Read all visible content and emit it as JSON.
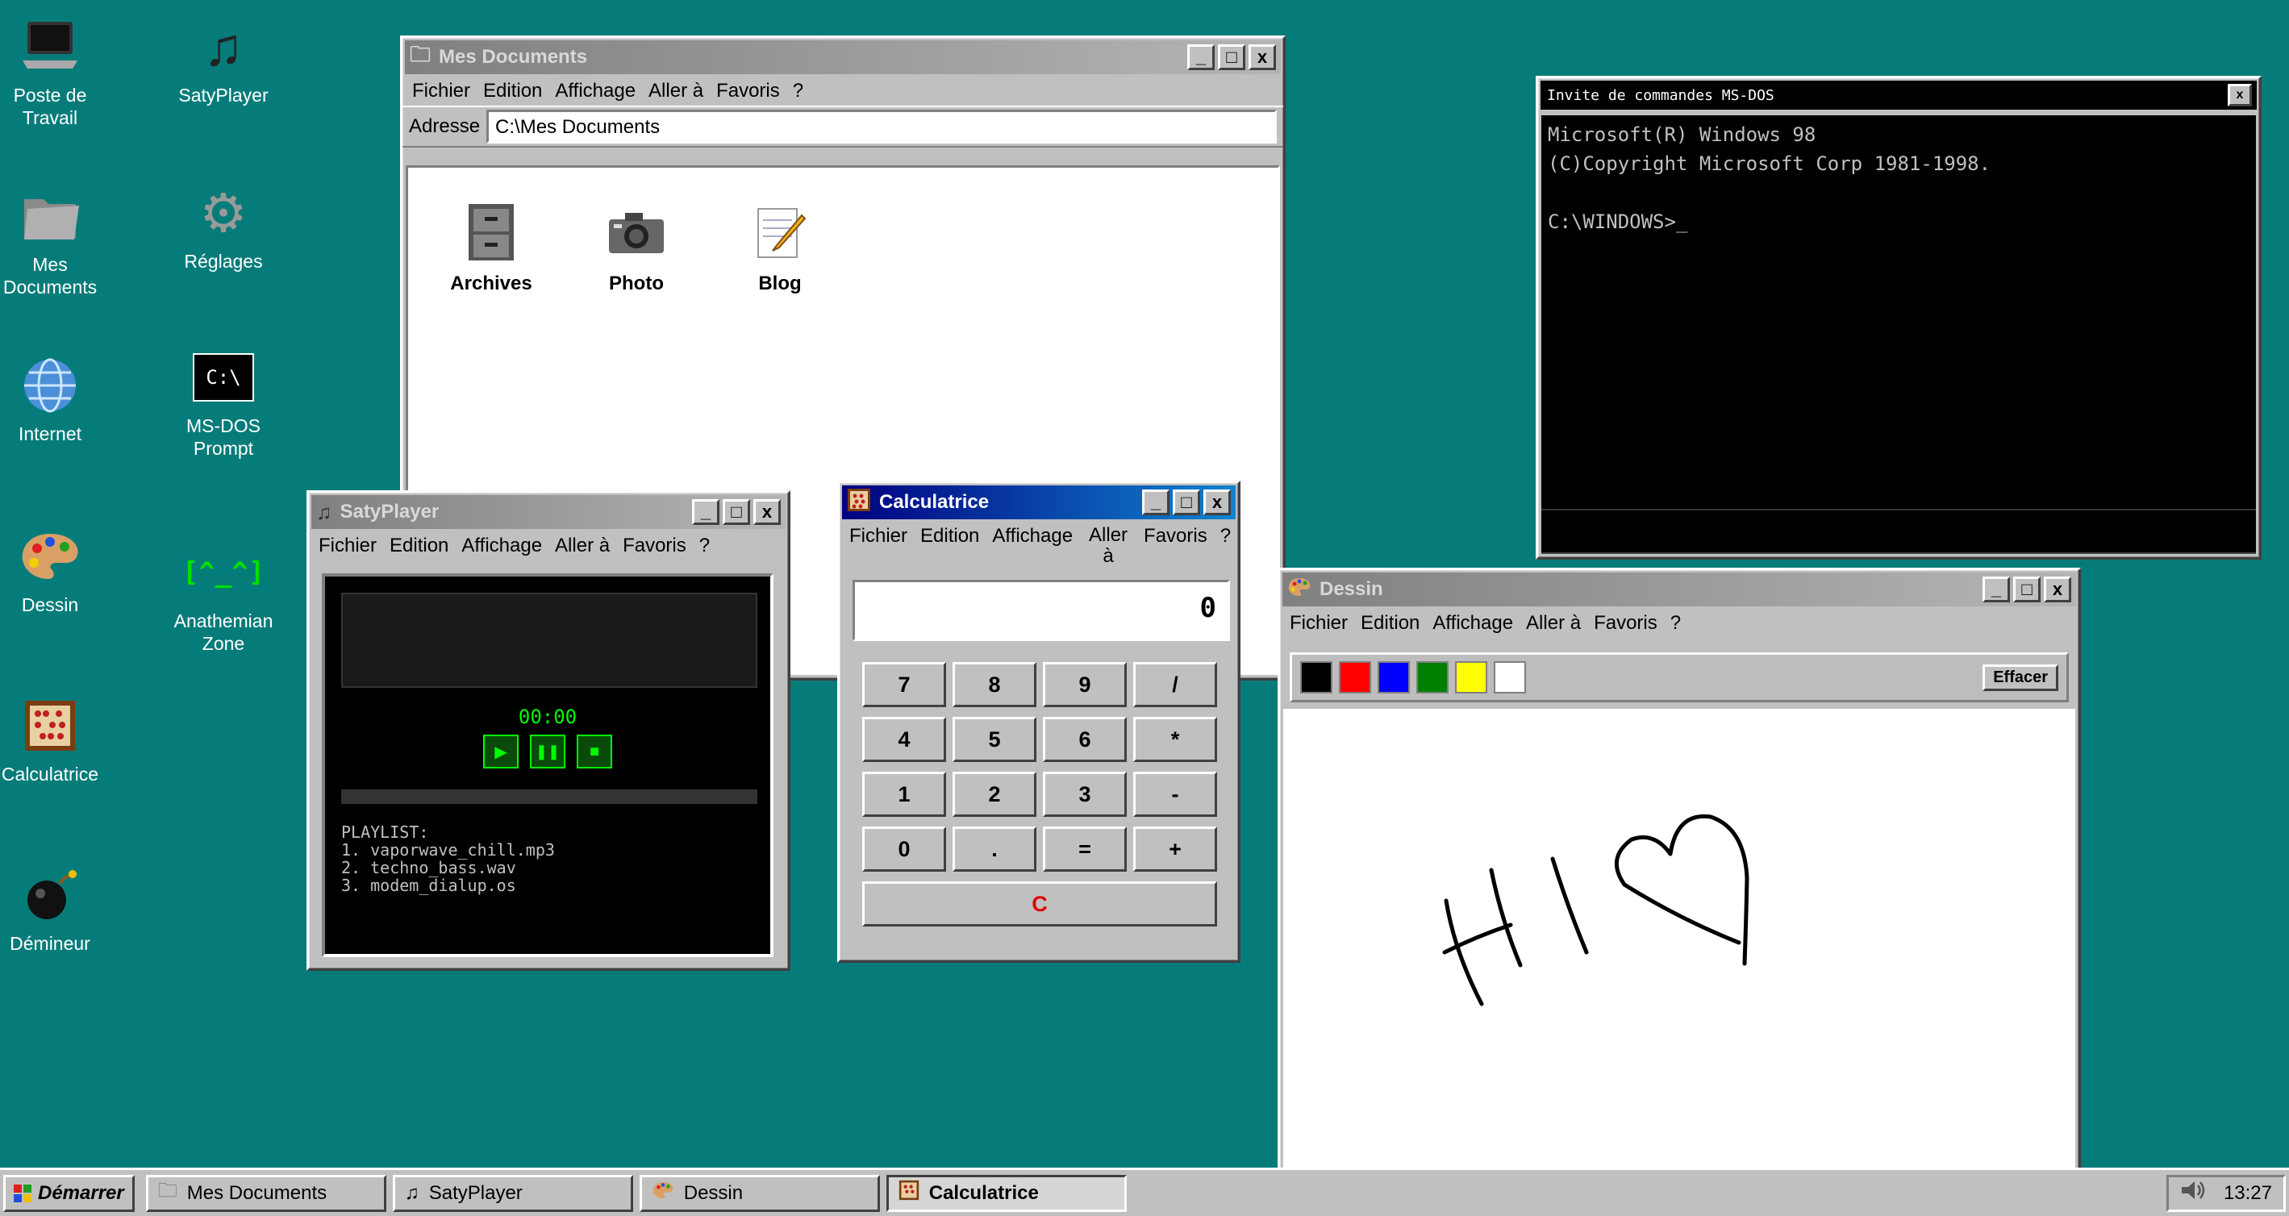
{
  "desktop": {
    "icons": [
      {
        "label": "Poste de Travail",
        "icon": "computer-icon"
      },
      {
        "label": "SatyPlayer",
        "icon": "music-note-icon"
      },
      {
        "label": "Mes Documents",
        "icon": "folder-icon"
      },
      {
        "label": "Réglages",
        "icon": "gear-icon"
      },
      {
        "label": "Internet",
        "icon": "globe-icon"
      },
      {
        "label": "MS-DOS Prompt",
        "icon": "terminal-icon",
        "glyph": "C:\\"
      },
      {
        "label": "Dessin",
        "icon": "palette-icon"
      },
      {
        "label": "Anathemian Zone",
        "icon": "ascii-face-icon",
        "glyph": "[^_^]"
      },
      {
        "label": "Calculatrice",
        "icon": "abacus-icon"
      },
      {
        "label": "Démineur",
        "icon": "bomb-icon"
      }
    ]
  },
  "explorer": {
    "title": "Mes Documents",
    "menu": [
      "Fichier",
      "Edition",
      "Affichage",
      "Aller à",
      "Favoris",
      "?"
    ],
    "address_label": "Adresse",
    "address_value": "C:\\Mes Documents",
    "items": [
      {
        "label": "Archives",
        "icon": "cabinet-icon"
      },
      {
        "label": "Photo",
        "icon": "camera-icon"
      },
      {
        "label": "Blog",
        "icon": "notepad-icon"
      }
    ]
  },
  "dos": {
    "title": "Invite de commandes MS-DOS",
    "lines": [
      "Microsoft(R) Windows 98",
      "(C)Copyright Microsoft Corp 1981-1998.",
      "",
      "C:\\WINDOWS>_"
    ]
  },
  "player": {
    "title": "SatyPlayer",
    "menu": [
      "Fichier",
      "Edition",
      "Affichage",
      "Aller à",
      "Favoris",
      "?"
    ],
    "time": "00:00",
    "controls": [
      "▶",
      "❚❚",
      "■"
    ],
    "playlist_header": "PLAYLIST:",
    "playlist": [
      "1. vaporwave_chill.mp3",
      "2. techno_bass.wav",
      "3. modem_dialup.os"
    ],
    "accent": "#00ff00"
  },
  "calc": {
    "title": "Calculatrice",
    "menu": [
      "Fichier",
      "Edition",
      "Affichage",
      "Aller à",
      "Favoris",
      "?"
    ],
    "display": "0",
    "keys": [
      "7",
      "8",
      "9",
      "/",
      "4",
      "5",
      "6",
      "*",
      "1",
      "2",
      "3",
      "-",
      "0",
      ".",
      "=",
      "+"
    ],
    "clear": "C"
  },
  "paint": {
    "title": "Dessin",
    "menu": [
      "Fichier",
      "Edition",
      "Affichage",
      "Aller à",
      "Favoris",
      "?"
    ],
    "colors": [
      "#000000",
      "#ff0000",
      "#0000ff",
      "#008000",
      "#ffff00",
      "#ffffff"
    ],
    "clear_button": "Effacer"
  },
  "taskbar": {
    "start": "Démarrer",
    "tasks": [
      {
        "label": "Mes Documents",
        "icon": "folder-icon"
      },
      {
        "label": "SatyPlayer",
        "icon": "music-note-icon"
      },
      {
        "label": "Dessin",
        "icon": "palette-icon"
      },
      {
        "label": "Calculatrice",
        "icon": "abacus-icon"
      }
    ],
    "clock": "13:27"
  }
}
